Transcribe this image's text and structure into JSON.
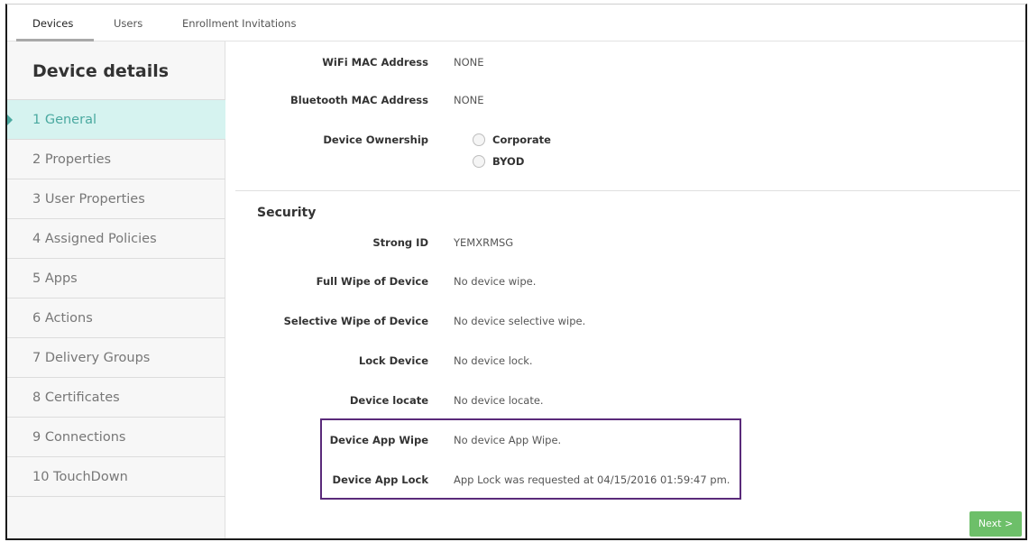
{
  "tabs": [
    {
      "label": "Devices"
    },
    {
      "label": "Users"
    },
    {
      "label": "Enrollment Invitations"
    }
  ],
  "sidebar": {
    "title": "Device details",
    "items": [
      {
        "label": "1  General"
      },
      {
        "label": "2  Properties"
      },
      {
        "label": "3  User Properties"
      },
      {
        "label": "4  Assigned Policies"
      },
      {
        "label": "5  Apps"
      },
      {
        "label": "6  Actions"
      },
      {
        "label": "7  Delivery Groups"
      },
      {
        "label": "8  Certificates"
      },
      {
        "label": "9  Connections"
      },
      {
        "label": "10  TouchDown"
      }
    ]
  },
  "general": {
    "wifi_label": "WiFi MAC Address",
    "wifi_value": "NONE",
    "bt_label": "Bluetooth MAC Address",
    "bt_value": "NONE",
    "ownership_label": "Device Ownership",
    "ownership_options": [
      "Corporate",
      "BYOD"
    ]
  },
  "security": {
    "title": "Security",
    "rows": [
      {
        "label": "Strong ID",
        "value": "YEMXRMSG"
      },
      {
        "label": "Full Wipe of Device",
        "value": "No device wipe."
      },
      {
        "label": "Selective Wipe of Device",
        "value": "No device selective wipe."
      },
      {
        "label": "Lock Device",
        "value": "No device lock."
      },
      {
        "label": "Device locate",
        "value": "No device locate."
      },
      {
        "label": "Device App Wipe",
        "value": "No device App Wipe."
      },
      {
        "label": "Device App Lock",
        "value": "App Lock was requested at 04/15/2016 01:59:47 pm."
      }
    ]
  },
  "footer": {
    "next_label": "Next >"
  },
  "colors": {
    "active_item_bg": "#d6f3f0",
    "accent": "#4aa9a0",
    "next_button": "#6dbf69",
    "highlight_border": "#5a2a7a"
  }
}
